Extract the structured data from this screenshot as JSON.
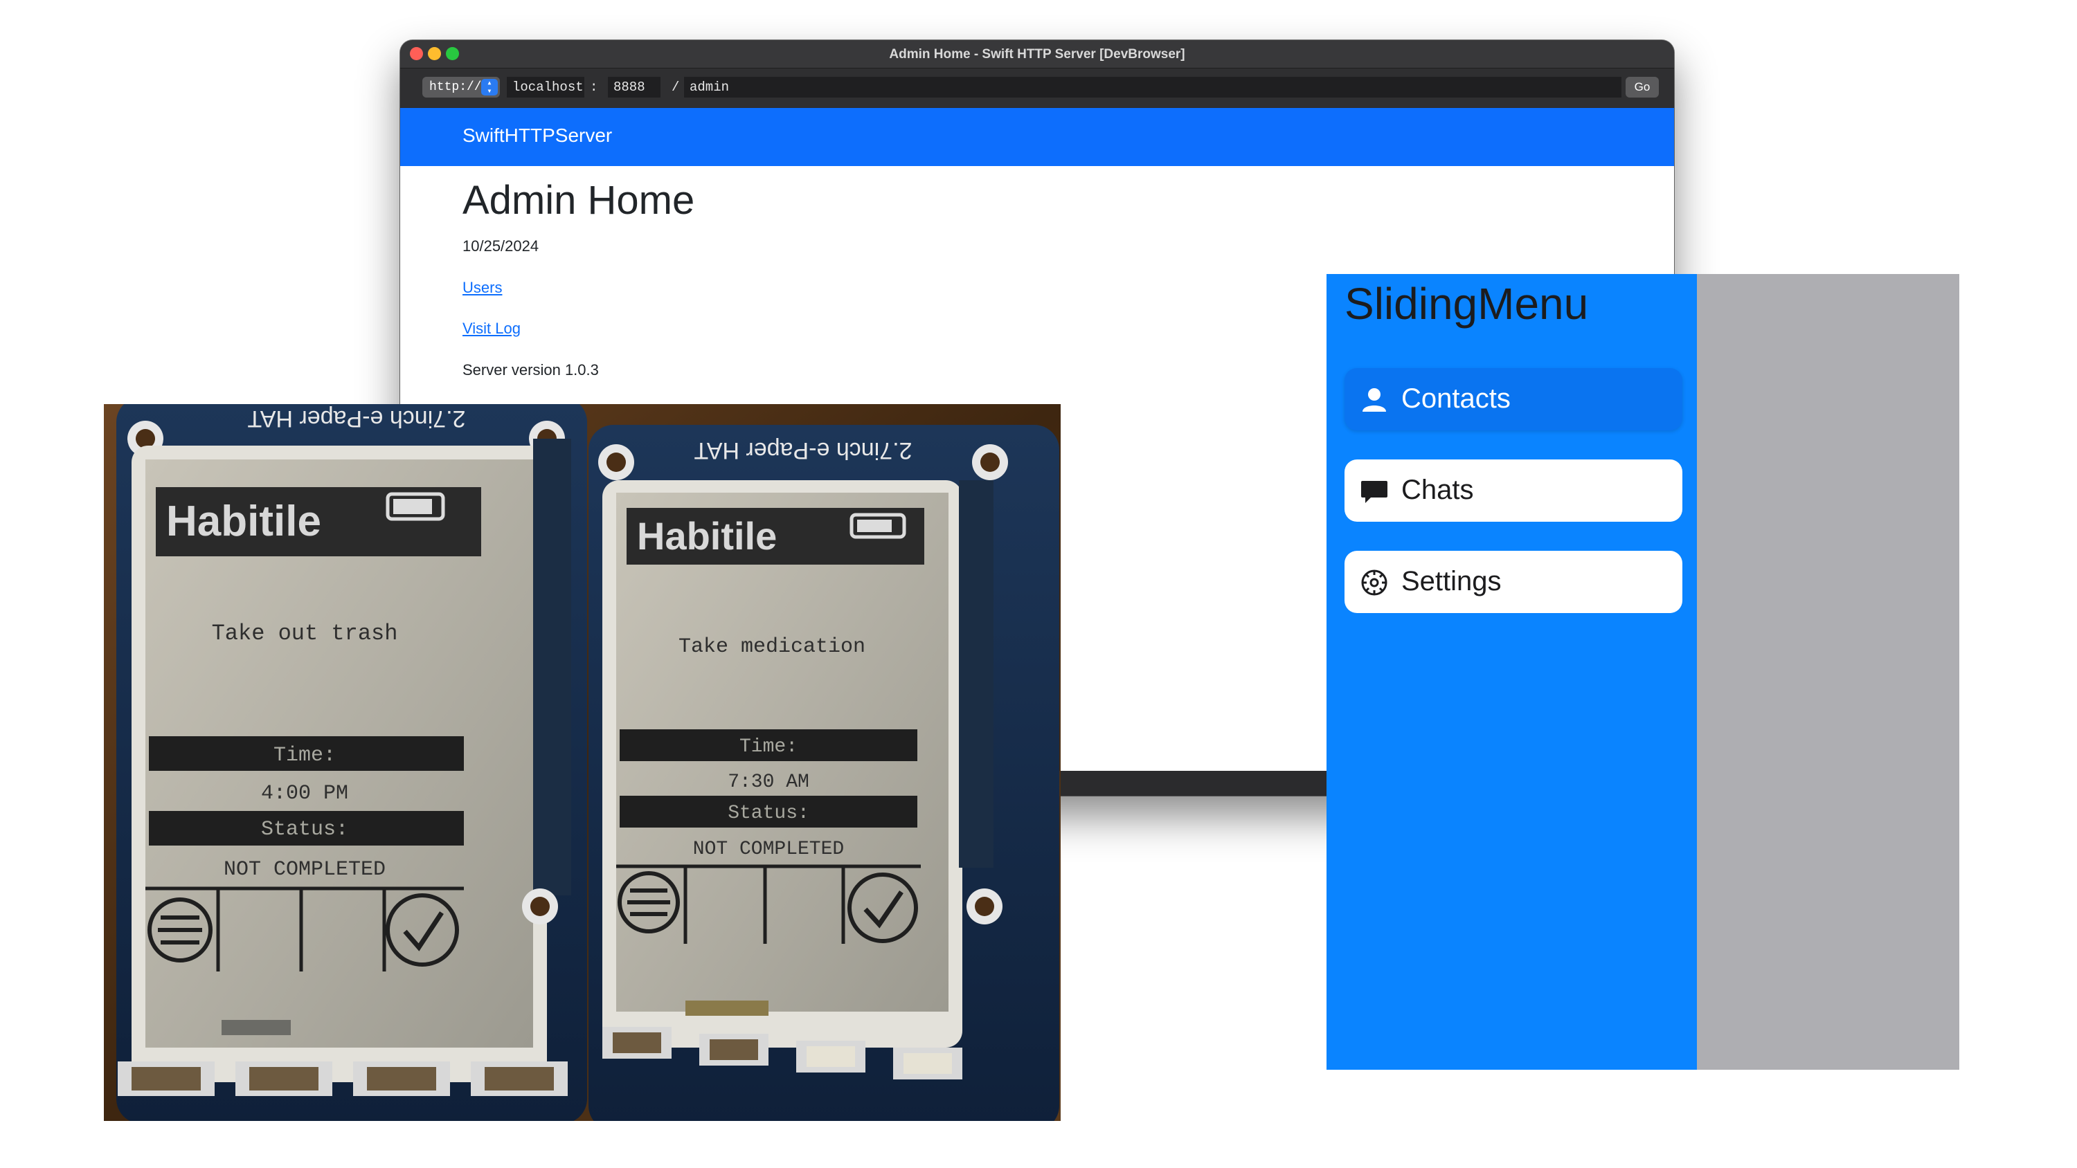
{
  "browser": {
    "window_title": "Admin Home - Swift HTTP Server [DevBrowser]",
    "scheme": "http://",
    "host": "localhost",
    "port_separator": ":",
    "port": "8888",
    "path_separator": "/",
    "path": "admin",
    "go_label": "Go"
  },
  "site": {
    "brand": "SwiftHTTPServer",
    "title": "Admin Home",
    "date": "10/25/2024",
    "links": [
      "Users",
      "Visit Log"
    ],
    "version": "Server version 1.0.3",
    "accent_color": "#0d6efd"
  },
  "photo": {
    "board_label": "2.7inch e-Paper HAT",
    "left_device": {
      "app": "Habitile",
      "task": "Take out trash",
      "time_label": "Time:",
      "time": "4:00 PM",
      "status_label": "Status:",
      "status": "NOT COMPLETED"
    },
    "right_device": {
      "app": "Habitile",
      "task": "Take medication",
      "time_label": "Time:",
      "time": "7:30 AM",
      "status_label": "Status:",
      "status": "NOT COMPLETED"
    }
  },
  "sliding_menu": {
    "title": "SlidingMenu",
    "accent_color": "#0a84ff",
    "items": [
      {
        "label": "Contacts",
        "icon": "person-icon",
        "active": true
      },
      {
        "label": "Chats",
        "icon": "chat-bubble-icon",
        "active": false
      },
      {
        "label": "Settings",
        "icon": "gear-icon",
        "active": false
      }
    ]
  }
}
